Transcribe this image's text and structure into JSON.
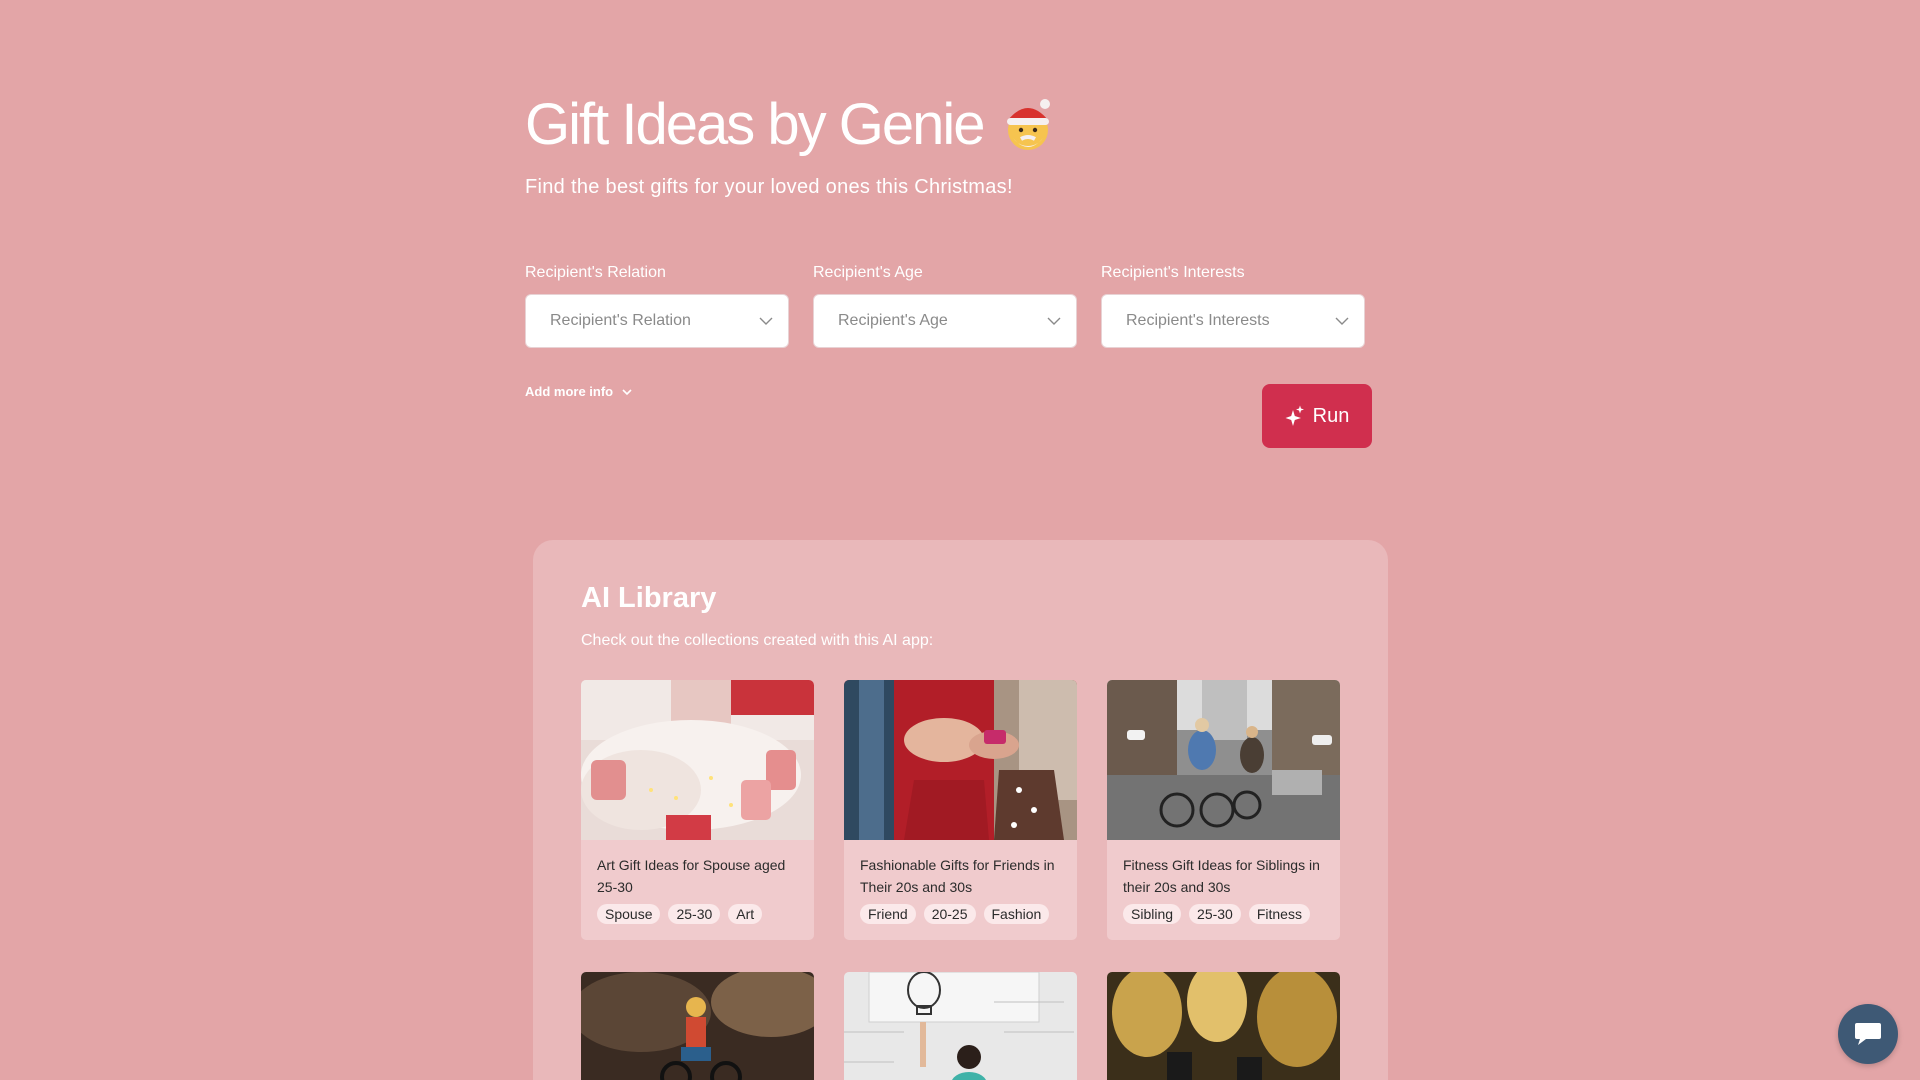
{
  "hero": {
    "title": "Gift Ideas by Genie",
    "title_emoji_icon": "santa-face-icon",
    "subtitle": "Find the best gifts for your loved ones this Christmas!"
  },
  "form": {
    "fields": [
      {
        "label": "Recipient's Relation",
        "placeholder": "Recipient's Relation"
      },
      {
        "label": "Recipient's Age",
        "placeholder": "Recipient's Age"
      },
      {
        "label": "Recipient's Interests",
        "placeholder": "Recipient's Interests"
      }
    ],
    "add_more": "Add more info",
    "run": "Run"
  },
  "library": {
    "title": "AI Library",
    "subtitle": "Check out the collections created with this AI app:",
    "cards": [
      {
        "title": "Art Gift Ideas for Spouse aged 25-30",
        "tags": [
          "Spouse",
          "25-30",
          "Art"
        ]
      },
      {
        "title": "Fashionable Gifts for Friends in Their 20s and 30s",
        "tags": [
          "Friend",
          "20-25",
          "Fashion"
        ]
      },
      {
        "title": "Fitness Gift Ideas for Siblings in their 20s and 30s",
        "tags": [
          "Sibling",
          "25-30",
          "Fitness"
        ]
      }
    ]
  },
  "colors": {
    "background": "#e3a5a7",
    "panel": "#e9b8ba",
    "card": "#f0cbcd",
    "accent": "#d02f4e",
    "chat": "#3e5975"
  }
}
